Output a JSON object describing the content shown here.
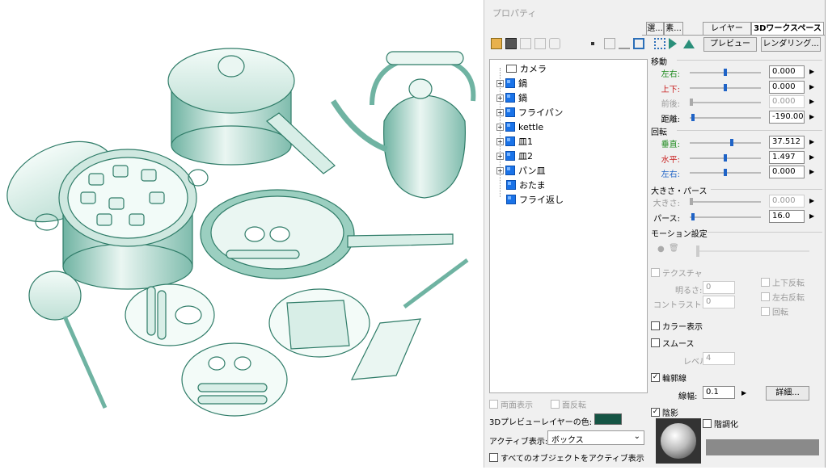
{
  "window": {
    "title": "プロパティ"
  },
  "tabs": [
    "選...",
    "素...",
    "レイヤー",
    "3Dワークスペース"
  ],
  "toolbar": {
    "preview": "プレビュー",
    "render": "レンダリング..."
  },
  "tree": {
    "items": [
      "カメラ",
      "鍋",
      "鍋",
      "フライパン",
      "kettle",
      "皿1",
      "皿2",
      "パン皿",
      "おたま",
      "フライ返し"
    ]
  },
  "move": {
    "title": "移動",
    "rows": [
      {
        "label": "左右:",
        "value": "0.000",
        "color": "#1d8a1d",
        "pos": 0.5
      },
      {
        "label": "上下:",
        "value": "0.000",
        "color": "#c81e1e",
        "pos": 0.5
      },
      {
        "label": "前後:",
        "value": "0.000",
        "color": "#999999",
        "pos": 0.0
      },
      {
        "label": "距離:",
        "value": "-190.000",
        "color": "#000000",
        "pos": 0.02
      }
    ]
  },
  "rotate": {
    "title": "回転",
    "rows": [
      {
        "label": "垂直:",
        "value": "37.512",
        "color": "#1d8a1d",
        "pos": 0.6
      },
      {
        "label": "水平:",
        "value": "1.497",
        "color": "#c81e1e",
        "pos": 0.5
      },
      {
        "label": "左右:",
        "value": "0.000",
        "color": "#1f63c6",
        "pos": 0.5
      }
    ]
  },
  "size": {
    "title": "大きさ・パース",
    "rows": [
      {
        "label": "大きさ:",
        "value": "0.000",
        "color": "#999999",
        "pos": 0.0
      },
      {
        "label": "パース:",
        "value": "16.0",
        "color": "#000000",
        "pos": 0.02
      }
    ]
  },
  "motion": {
    "title": "モーション設定"
  },
  "texture": {
    "label": "テクスチャ",
    "brightness": "明るさ:",
    "bright_val": "0",
    "contrast": "コントラスト:",
    "contrast_val": "0",
    "flip_v": "上下反転",
    "flip_h": "左右反転",
    "rotate": "回転"
  },
  "color_display": "カラー表示",
  "smooth": {
    "label": "スムース",
    "level": "レベル:",
    "level_val": "4"
  },
  "outline": {
    "label": "輪郭線",
    "width_label": "線幅:",
    "width_val": "0.1 mm",
    "detail": "詳細..."
  },
  "shadow": {
    "label": "陰影",
    "posterize": "階調化"
  },
  "bottom": {
    "double_side": "両面表示",
    "flip_face": "面反転",
    "layer_color": "3Dプレビューレイヤーの色:",
    "layer_color_hex": "#155444",
    "active_label": "アクティブ表示:",
    "active_value": "ボックス",
    "all_active": "すべてのオブジェクトをアクティブ表示"
  },
  "colors": {
    "model": "#dff1ec",
    "model_dark": "#3e8f7c"
  }
}
